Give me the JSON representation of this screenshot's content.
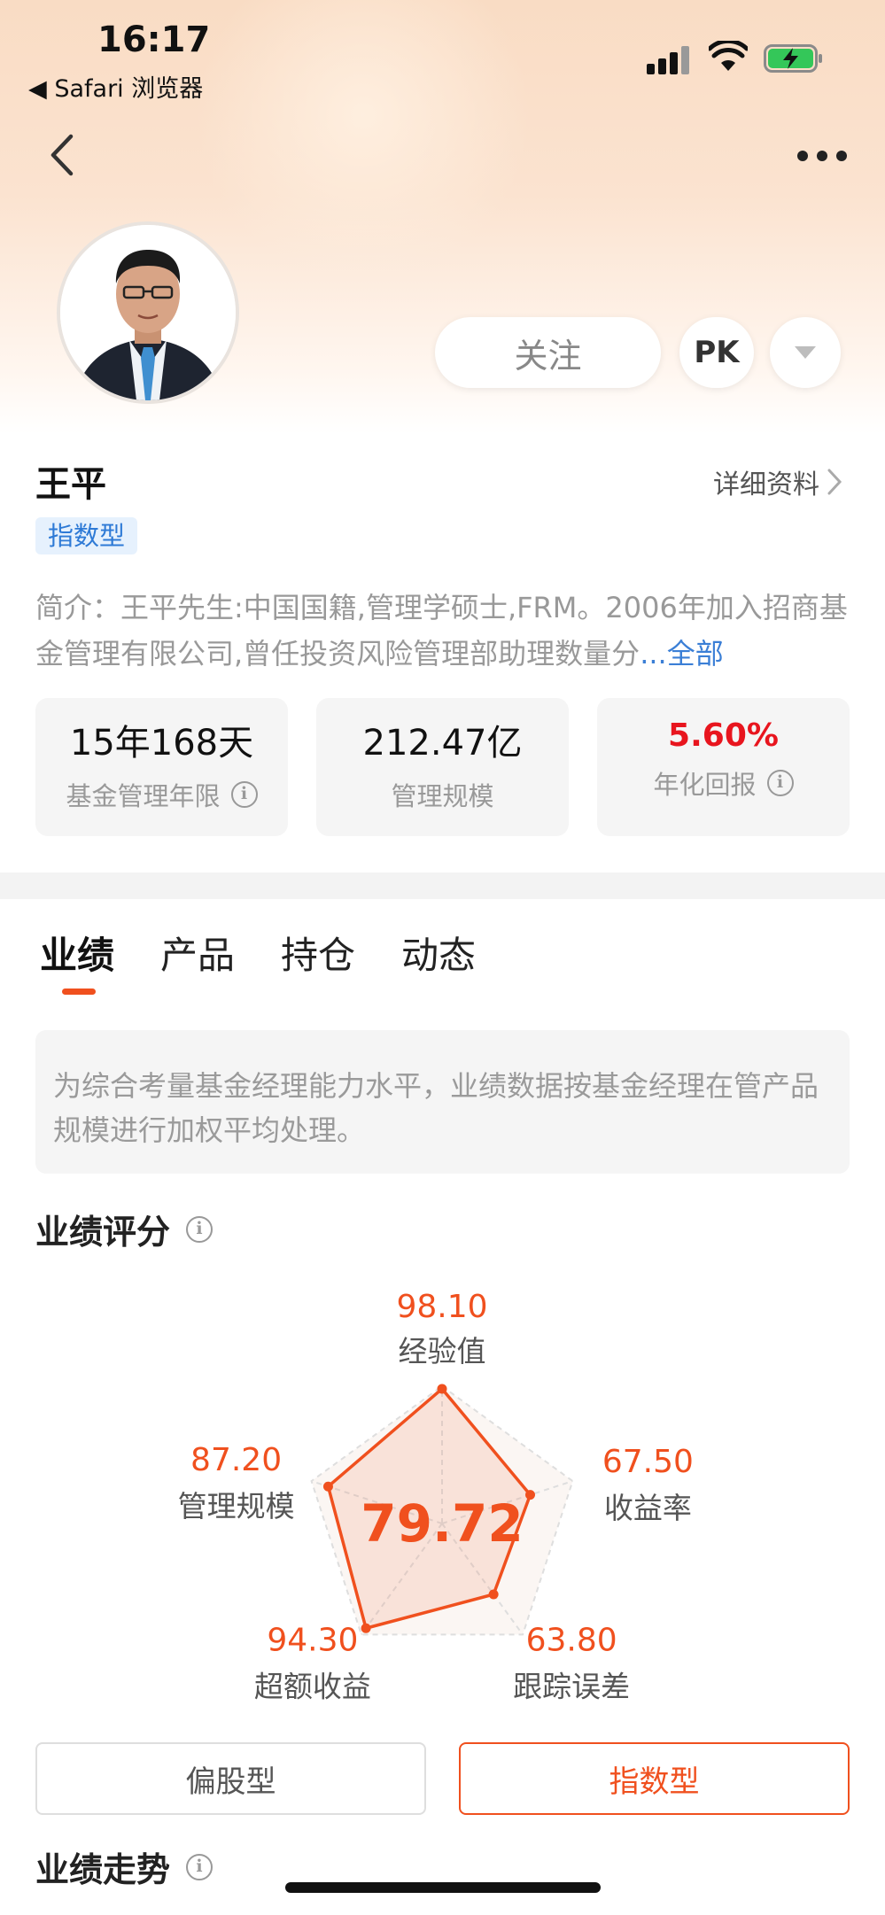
{
  "status_bar": {
    "time": "16:17",
    "back_app": "◀ Safari 浏览器"
  },
  "profile": {
    "name": "王平",
    "detail_link": "详细资料",
    "type_tag": "指数型",
    "intro_text": "简介：王平先生:中国国籍,管理学硕士,FRM。2006年加入招商基金管理有限公司,曾任投资风险管理部助理数量分",
    "intro_more": "...全部"
  },
  "actions": {
    "follow": "关注",
    "pk": "PK"
  },
  "stats": [
    {
      "value": "15年168天",
      "label": "基金管理年限"
    },
    {
      "value": "212.47亿",
      "label": "管理规模"
    },
    {
      "value": "5.60%",
      "label": "年化回报"
    }
  ],
  "tabs": [
    "业绩",
    "产品",
    "持仓",
    "动态"
  ],
  "notice": "为综合考量基金经理能力水平，业绩数据按基金经理在管产品规模进行加权平均处理。",
  "score_section": {
    "title": "业绩评分",
    "total": "79.72",
    "max": 100,
    "axes": [
      {
        "label": "经验值",
        "value": "98.10"
      },
      {
        "label": "收益率",
        "value": "67.50"
      },
      {
        "label": "跟踪误差",
        "value": "63.80"
      },
      {
        "label": "超额收益",
        "value": "94.30"
      },
      {
        "label": "管理规模",
        "value": "87.20"
      }
    ]
  },
  "segments": [
    {
      "label": "偏股型",
      "active": false
    },
    {
      "label": "指数型",
      "active": true
    }
  ],
  "trend_section": {
    "title": "业绩走势"
  },
  "colors": {
    "accent": "#f0501e",
    "red": "#e8151e",
    "link_blue": "#3b7fd6"
  }
}
